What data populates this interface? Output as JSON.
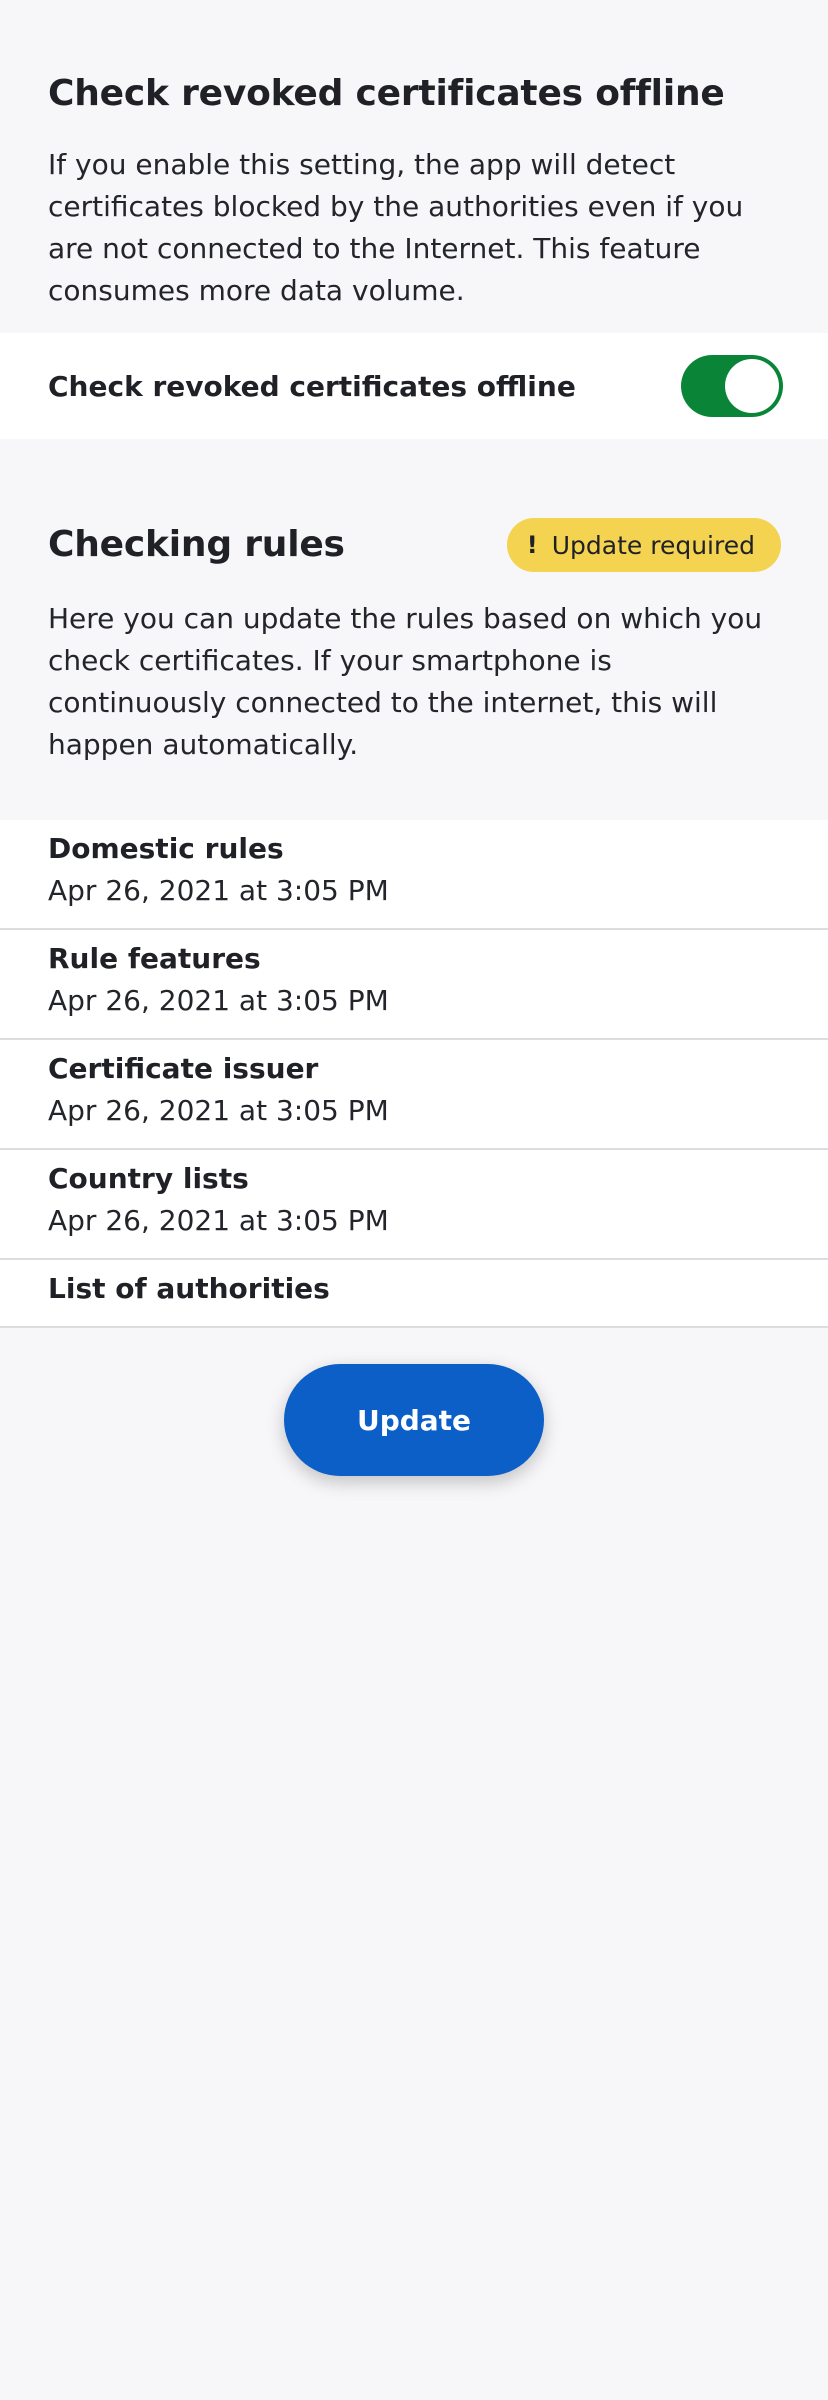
{
  "offline_section": {
    "title": "Check revoked certificates offline",
    "description": "If you enable this setting, the app will detect certificates blocked by the authorities even if you are not connected to the Internet. This feature consumes more data volume.",
    "toggle_label": "Check revoked certificates offline",
    "toggle_on": true
  },
  "rules_section": {
    "title": "Checking rules",
    "badge": "Update required",
    "badge_icon": "exclamation-icon",
    "description": "Here you can update the rules based on which you check certificates. If your smartphone is continuously connected to the internet, this will happen automatically.",
    "items": [
      {
        "title": "Domestic rules",
        "date": "Apr 26, 2021 at 3:05 PM"
      },
      {
        "title": "Rule features",
        "date": "Apr 26, 2021 at 3:05 PM"
      },
      {
        "title": "Certificate issuer",
        "date": "Apr 26, 2021 at 3:05 PM"
      },
      {
        "title": "Country lists",
        "date": "Apr 26, 2021 at 3:05 PM"
      },
      {
        "title": "List of authorities"
      }
    ]
  },
  "update_button": "Update",
  "colors": {
    "background": "#f7f7f9",
    "toggle_on": "#0a8537",
    "badge": "#f4d351",
    "primary_button": "#0b5fc6"
  }
}
